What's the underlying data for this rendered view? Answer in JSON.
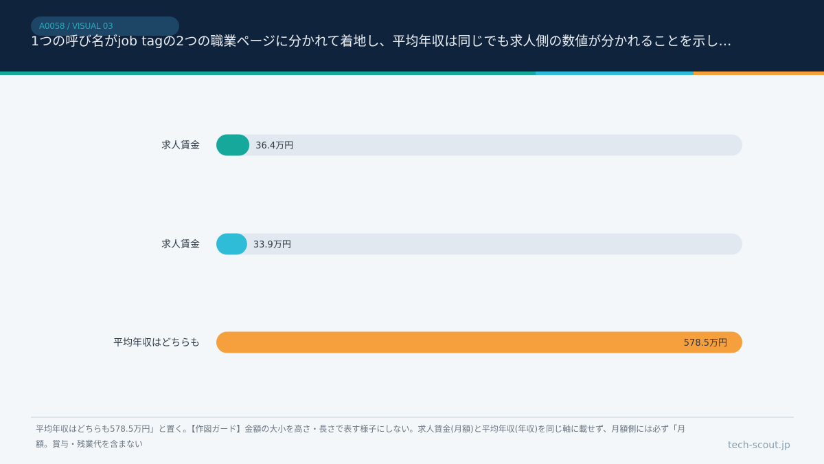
{
  "header": {
    "badge": "A0058 / VISUAL 03",
    "title": "1つの呼び名がjob tagの2つの職業ページに分かれて着地し、平均年収は同じでも求人側の数値が分かれることを示し…"
  },
  "colors": {
    "header_bg": "#10233d",
    "stripe_teal": "#15a89b",
    "stripe_blue": "#2fbcd6",
    "stripe_orange": "#f59f3d",
    "track": "#e1e8ef"
  },
  "chart_data": {
    "type": "bar",
    "orientation": "horizontal",
    "categories": [
      "求人賃金",
      "求人賃金",
      "平均年収はどちらも"
    ],
    "values": [
      36.4,
      33.9,
      578.5
    ],
    "value_labels": [
      "36.4万円",
      "33.9万円",
      "578.5万円"
    ],
    "bar_colors": [
      "#15a89b",
      "#2fbcd6",
      "#f59f3d"
    ],
    "xlim": [
      0,
      578.5
    ],
    "title": "",
    "xlabel": "",
    "ylabel": "",
    "grid": false,
    "legend": "none"
  },
  "footer": {
    "note": "平均年収はどちらも578.5万円」と置く。【作図ガード】金額の大小を高さ・長さで表す様子にしない。求人賃金(月額)と平均年収(年収)を同じ軸に載せず、月額側には必ず「月額。賞与・残業代を含まない",
    "brand": "tech-scout.jp"
  }
}
